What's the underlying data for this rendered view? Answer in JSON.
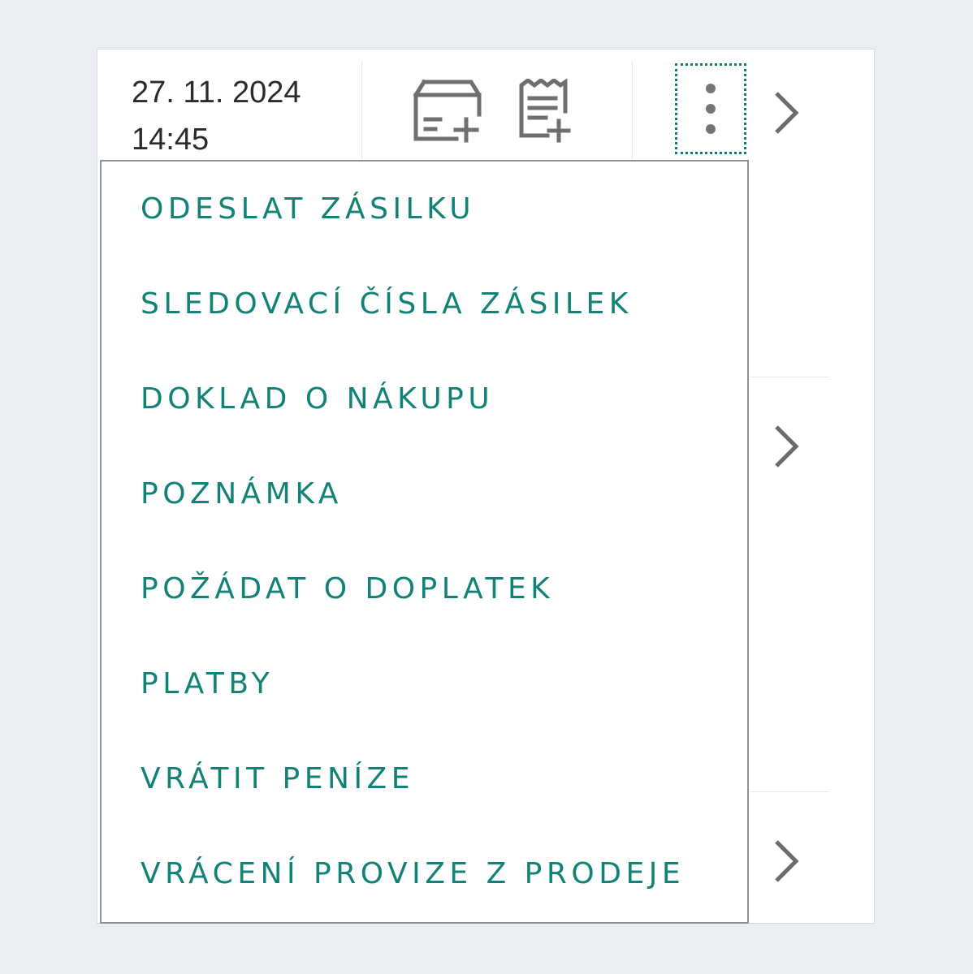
{
  "row": {
    "date": "27. 11. 2024",
    "time": "14:45"
  },
  "icons": {
    "add_shipment": "package-add-icon",
    "add_receipt": "receipt-add-icon",
    "more": "more-vertical-icon",
    "chevron": "chevron-right-icon"
  },
  "menu": {
    "items": [
      {
        "label": "ODESLAT ZÁSILKU"
      },
      {
        "label": "SLEDOVACÍ ČÍSLA ZÁSILEK"
      },
      {
        "label": "DOKLAD O NÁKUPU"
      },
      {
        "label": "POZNÁMKA"
      },
      {
        "label": "POŽÁDAT O DOPLATEK"
      },
      {
        "label": "PLATBY"
      },
      {
        "label": "VRÁTIT PENÍZE"
      },
      {
        "label": "VRÁCENÍ PROVIZE Z PRODEJE"
      }
    ]
  },
  "colors": {
    "accent": "#128276",
    "background": "#eaedf1"
  }
}
